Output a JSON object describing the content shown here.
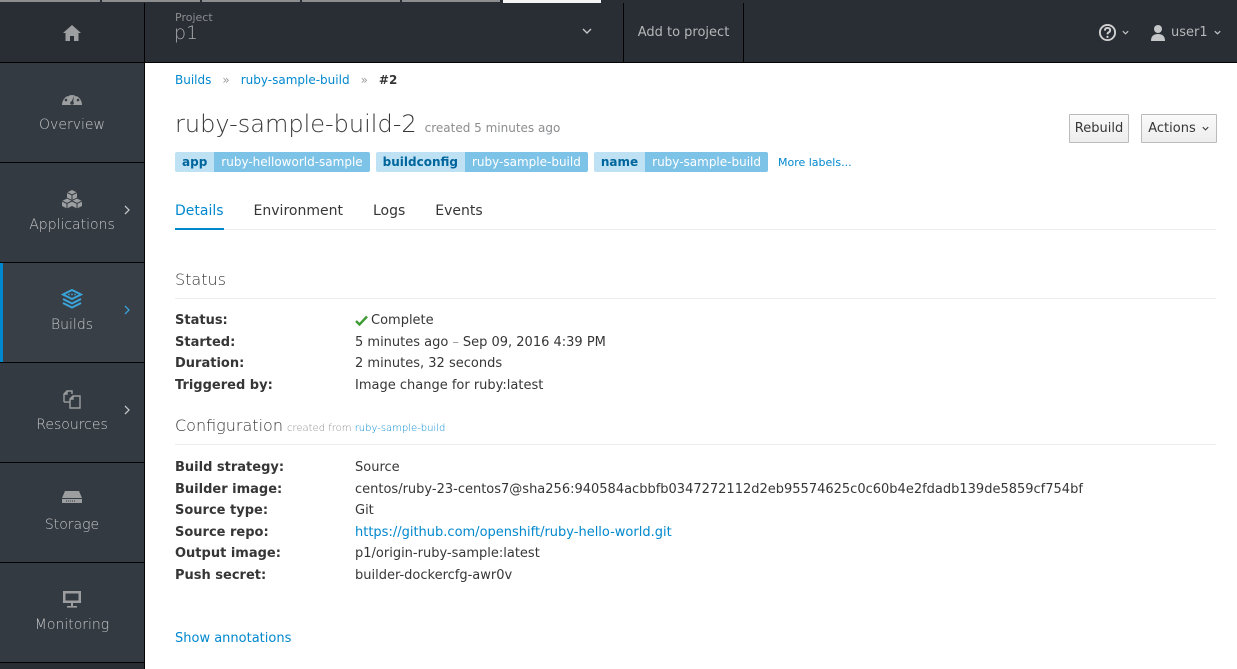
{
  "header": {
    "project_label": "Project",
    "project_name": "p1",
    "add_to_project": "Add to project",
    "username": "user1"
  },
  "sidebar": {
    "items": [
      {
        "label": "Overview",
        "icon": "dashboard-icon",
        "has_arrow": false,
        "active": false
      },
      {
        "label": "Applications",
        "icon": "cubes-icon",
        "has_arrow": true,
        "active": false
      },
      {
        "label": "Builds",
        "icon": "builds-icon",
        "has_arrow": true,
        "active": true
      },
      {
        "label": "Resources",
        "icon": "files-icon",
        "has_arrow": true,
        "active": false
      },
      {
        "label": "Storage",
        "icon": "storage-icon",
        "has_arrow": false,
        "active": false
      },
      {
        "label": "Monitoring",
        "icon": "monitor-icon",
        "has_arrow": false,
        "active": false
      }
    ]
  },
  "breadcrumb": {
    "items": [
      "Builds",
      "ruby-sample-build"
    ],
    "current": "#2"
  },
  "page": {
    "title": "ruby-sample-build-2",
    "subtitle": "created 5 minutes ago",
    "rebuild_label": "Rebuild",
    "actions_label": "Actions"
  },
  "labels": [
    {
      "key": "app",
      "value": "ruby-helloworld-sample"
    },
    {
      "key": "buildconfig",
      "value": "ruby-sample-build"
    },
    {
      "key": "name",
      "value": "ruby-sample-build"
    }
  ],
  "more_labels": "More labels...",
  "tabs": [
    {
      "label": "Details",
      "active": true
    },
    {
      "label": "Environment",
      "active": false
    },
    {
      "label": "Logs",
      "active": false
    },
    {
      "label": "Events",
      "active": false
    }
  ],
  "status_section": {
    "title": "Status",
    "rows": {
      "status": {
        "label": "Status:",
        "value": "Complete"
      },
      "started": {
        "label": "Started:",
        "relative": "5 minutes ago",
        "separator": "–",
        "absolute": "Sep 09, 2016 4:39 PM"
      },
      "duration": {
        "label": "Duration:",
        "value": "2 minutes, 32 seconds"
      },
      "triggered": {
        "label": "Triggered by:",
        "value": "Image change for ruby:latest"
      }
    }
  },
  "config_section": {
    "title": "Configuration",
    "created_from_text": "created from",
    "created_from_link": "ruby-sample-build",
    "rows": {
      "strategy": {
        "label": "Build strategy:",
        "value": "Source"
      },
      "builder_image": {
        "label": "Builder image:",
        "value": "centos/ruby-23-centos7@sha256:940584acbbfb0347272112d2eb95574625c0c60b4e2fdadb139de5859cf754bf"
      },
      "source_type": {
        "label": "Source type:",
        "value": "Git"
      },
      "source_repo": {
        "label": "Source repo:",
        "value": "https://github.com/openshift/ruby-hello-world.git"
      },
      "output_image": {
        "label": "Output image:",
        "value": "p1/origin-ruby-sample:latest"
      },
      "push_secret": {
        "label": "Push secret:",
        "value": "builder-dockercfg-awr0v"
      }
    }
  },
  "show_annotations": "Show annotations",
  "colors": {
    "accent": "#0088ce",
    "nav_bg": "#292e34",
    "success": "#3f9c35"
  }
}
